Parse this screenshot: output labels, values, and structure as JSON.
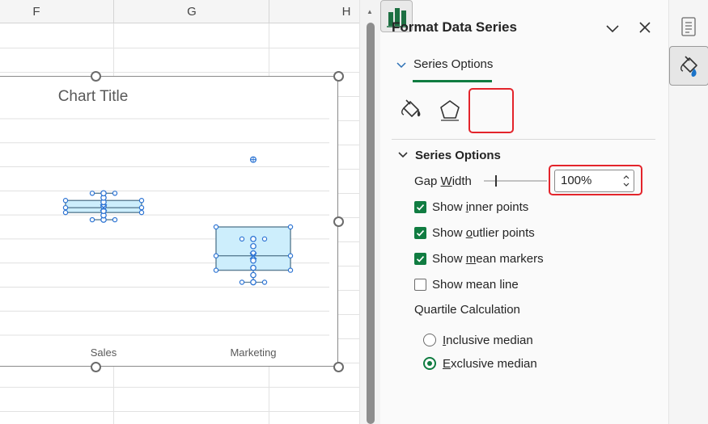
{
  "sheet": {
    "columns": [
      "F",
      "G",
      "H"
    ]
  },
  "chart_data": {
    "type": "box",
    "title": "Chart Title",
    "categories": [
      "Sales",
      "Marketing"
    ],
    "boxes": [
      {
        "category": "Sales",
        "whisker_low": 48,
        "q1": 51,
        "median": 53,
        "q3": 56,
        "whisker_high": 59,
        "mean": 53
      },
      {
        "category": "Marketing",
        "whisker_low": 22,
        "q1": 27,
        "median": 33,
        "q3": 45,
        "whisker_high": 40,
        "mean": 33,
        "outliers": [
          73
        ]
      }
    ],
    "grid": true,
    "legend": "none"
  },
  "pane": {
    "title": "Format Data Series",
    "tab_label": "Series Options",
    "section_label": "Series Options",
    "gap_width_label": "Gap Width",
    "gap_width_value": "100%",
    "gap_width_slider_fraction": 0.0,
    "show_inner_points": {
      "label": "Show inner points",
      "checked": true
    },
    "show_outlier_points": {
      "label": "Show outlier points",
      "checked": true
    },
    "show_mean_markers": {
      "label": "Show mean markers",
      "checked": true
    },
    "show_mean_line": {
      "label": "Show mean line",
      "checked": false
    },
    "quartile_label": "Quartile Calculation",
    "inclusive_median": {
      "label": "Inclusive median",
      "selected": false
    },
    "exclusive_median": {
      "label": "Exclusive median",
      "selected": true
    },
    "icons": {
      "fill": "paint-bucket-icon",
      "effects": "pentagon-icon",
      "series": "bar-chart-icon",
      "dropdown": "chevron-down-icon",
      "close": "close-icon"
    }
  },
  "colors": {
    "accent": "#107c41",
    "highlight": "#e3242b",
    "box_fill": "#cdeefc",
    "box_stroke": "#5b7f95",
    "marker": "#2e75d4"
  },
  "rail": {
    "icons": [
      "properties-icon",
      "format-brush-icon"
    ]
  }
}
